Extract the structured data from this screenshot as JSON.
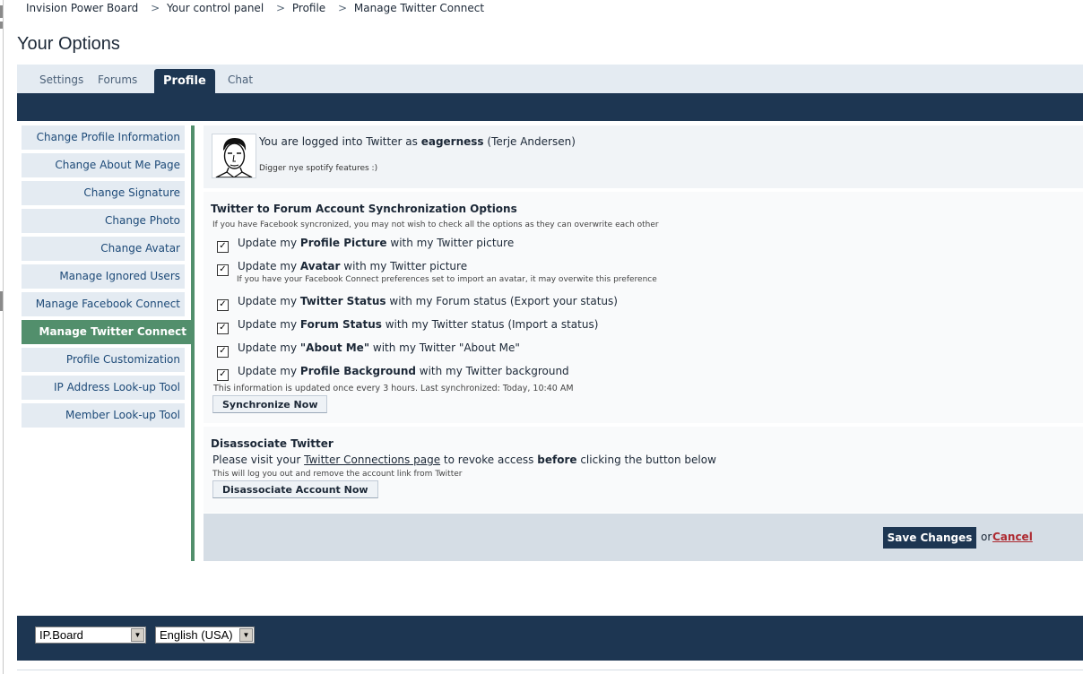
{
  "breadcrumb": [
    "Invision Power Board",
    "Your control panel",
    "Profile",
    "Manage Twitter Connect"
  ],
  "breadcrumb_sep": ">",
  "page_title": "Your Options",
  "tabs": [
    {
      "label": "Settings"
    },
    {
      "label": "Forums"
    },
    {
      "label": "Profile",
      "active": true
    },
    {
      "label": "Chat"
    }
  ],
  "sidebar": {
    "items": [
      {
        "label": "Change Profile Information"
      },
      {
        "label": "Change About Me Page"
      },
      {
        "label": "Change Signature"
      },
      {
        "label": "Change Photo"
      },
      {
        "label": "Change Avatar"
      },
      {
        "label": "Manage Ignored Users"
      },
      {
        "label": "Manage Facebook Connect"
      },
      {
        "label": "Manage Twitter Connect",
        "active": true
      },
      {
        "label": "Profile Customization"
      },
      {
        "label": "IP Address Look-up Tool"
      },
      {
        "label": "Member Look-up Tool"
      }
    ]
  },
  "twitter": {
    "login_prefix": "You are logged into Twitter as",
    "username": "eagerness",
    "realname": "(Terje Andersen)",
    "bio": "Digger nye spotify features :)"
  },
  "sync": {
    "title": "Twitter to Forum Account Synchronization Options",
    "desc": "If you have Facebook syncronized, you may not wish to check all the options as they can overwrite each other",
    "options": [
      {
        "pre": "Update my",
        "bold": "Profile Picture",
        "post": "with my Twitter picture",
        "checked": true
      },
      {
        "pre": "Update my",
        "bold": "Avatar",
        "post": "with my Twitter picture",
        "checked": true,
        "note": "If you have your Facebook Connect preferences set to import an avatar, it may overwite this preference"
      },
      {
        "pre": "Update my",
        "bold": "Twitter Status",
        "post": "with my Forum status (Export your status)",
        "checked": true
      },
      {
        "pre": "Update my",
        "bold": "Forum Status",
        "post": "with my Twitter status (Import a status)",
        "checked": true
      },
      {
        "pre": "Update my",
        "bold": "\"About Me\"",
        "post": "with my Twitter \"About Me\"",
        "checked": true
      },
      {
        "pre": "Update my",
        "bold": "Profile Background",
        "post": "with my Twitter background",
        "checked": true
      }
    ],
    "info": "This information is updated once every 3 hours. Last synchronized: Today, 10:40 AM",
    "sync_button": "Synchronize Now"
  },
  "disassociate": {
    "title": "Disassociate Twitter",
    "line_pre": "Please visit your",
    "link": "Twitter Connections page",
    "line_mid": "to revoke access",
    "line_bold": "before",
    "line_post": "clicking the button below",
    "note": "This will log you out and remove the account link from Twitter",
    "button": "Disassociate Account Now"
  },
  "actions": {
    "save": "Save Changes",
    "or": "or",
    "cancel": "Cancel"
  },
  "footer": {
    "skin_select": "IP.Board",
    "lang_select": "English (USA)"
  },
  "colors": {
    "navy": "#1d3652",
    "accent_green": "#528f6c",
    "light_panel": "#e4ebf2",
    "cancel_red": "#ad2930"
  }
}
